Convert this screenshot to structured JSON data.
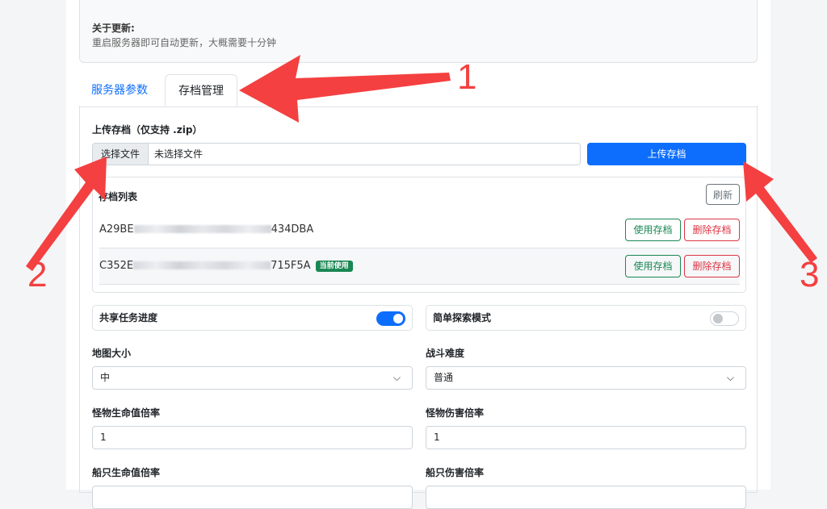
{
  "notice": {
    "title": "关于更新:",
    "desc": "重启服务器即可自动更新，大概需要十分钟"
  },
  "tabs": [
    {
      "label": "服务器参数"
    },
    {
      "label": "存档管理"
    }
  ],
  "upload": {
    "label": "上传存档（仅支持 .zip）",
    "choose": "选择文件",
    "no_file": "未选择文件",
    "button": "上传存档"
  },
  "saves": {
    "title": "存档列表",
    "refresh": "刷新",
    "rows": [
      {
        "prefix": "A29BE",
        "suffix": "434DBA",
        "current": "",
        "use": "使用存档",
        "del": "删除存档"
      },
      {
        "prefix": "C352E",
        "suffix": "715F5A",
        "current": "当前使用",
        "use": "使用存档",
        "del": "删除存档"
      }
    ]
  },
  "toggles": [
    {
      "label": "共享任务进度",
      "on": true
    },
    {
      "label": "简单探索模式",
      "on": false
    }
  ],
  "fields": {
    "map_size": {
      "label": "地图大小",
      "value": "中"
    },
    "difficulty": {
      "label": "战斗难度",
      "value": "普通"
    },
    "monster_hp": {
      "label": "怪物生命值倍率",
      "value": "1"
    },
    "monster_dmg": {
      "label": "怪物伤害倍率",
      "value": "1"
    },
    "ship_hp": {
      "label": "船只生命值倍率"
    },
    "ship_dmg": {
      "label": "船只伤害倍率"
    }
  },
  "annotations": [
    "1",
    "2",
    "3"
  ],
  "colors": {
    "primary": "#0d6efd",
    "success": "#198754",
    "danger": "#dc3545",
    "arrow": "#f44040"
  }
}
